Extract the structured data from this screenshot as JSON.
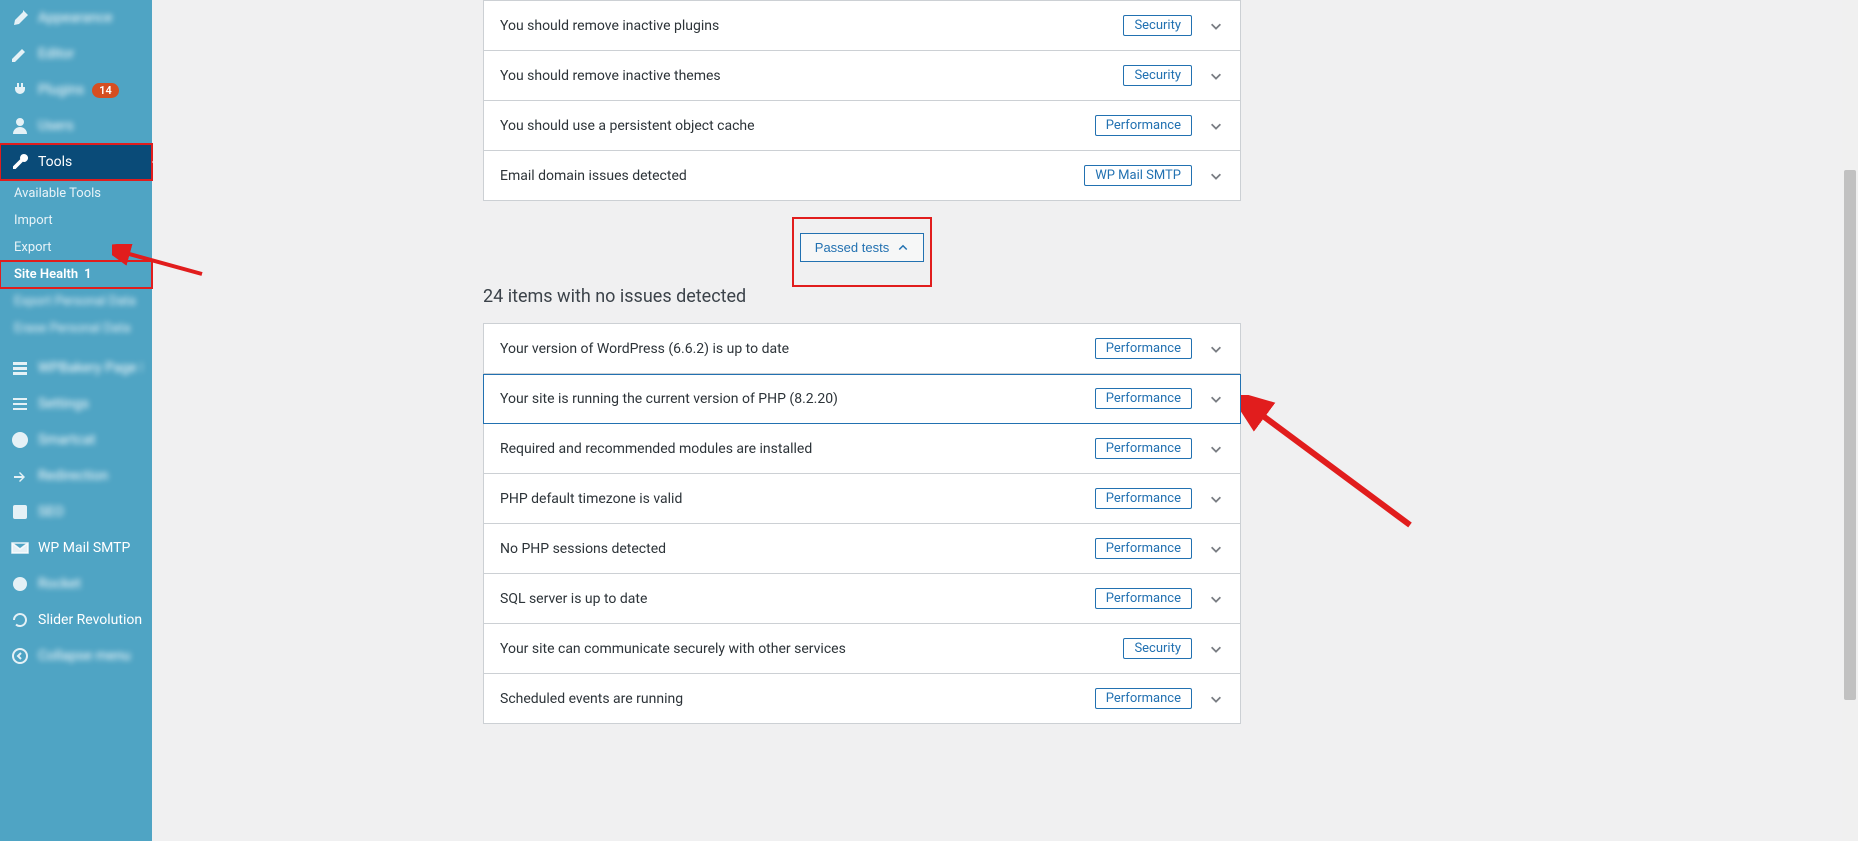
{
  "sidebar": {
    "items_top": [
      {
        "label": "Appearance",
        "icon": "brush"
      },
      {
        "label": "Editor",
        "icon": "pencil"
      },
      {
        "label": "Plugins",
        "icon": "plug",
        "badge": "14"
      },
      {
        "label": "Users",
        "icon": "user"
      }
    ],
    "tools": {
      "label": "Tools"
    },
    "submenu": [
      {
        "label": "Available Tools"
      },
      {
        "label": "Import"
      },
      {
        "label": "Export"
      },
      {
        "label": "Site Health",
        "badge": "1",
        "bold": true
      },
      {
        "label": "Export Personal Data",
        "blur": true
      },
      {
        "label": "Erase Personal Data",
        "blur": true
      }
    ],
    "items_bottom": [
      {
        "label": "WPBakery Page Builder",
        "icon": "layers",
        "blur": true
      },
      {
        "label": "Settings",
        "icon": "sliders",
        "blur": true
      },
      {
        "label": "Smartcat",
        "icon": "whatsapp",
        "blur": true
      },
      {
        "label": "Redirection",
        "icon": "share",
        "blur": true
      },
      {
        "label": "SEO",
        "icon": "seo",
        "blur": true
      },
      {
        "label": "WP Mail SMTP",
        "icon": "mail",
        "blur": false
      },
      {
        "label": "Rocket",
        "icon": "circle",
        "blur": true
      },
      {
        "label": "Slider Revolution",
        "icon": "refresh",
        "blur": false
      },
      {
        "label": "Collapse menu",
        "icon": "collapse",
        "blur": true
      }
    ]
  },
  "recommended": [
    {
      "title": "You should remove inactive plugins",
      "pill": "Security"
    },
    {
      "title": "You should remove inactive themes",
      "pill": "Security"
    },
    {
      "title": "You should use a persistent object cache",
      "pill": "Performance"
    },
    {
      "title": "Email domain issues detected",
      "pill": "WP Mail SMTP"
    }
  ],
  "passed_button": "Passed tests",
  "passed_heading": "24 items with no issues detected",
  "passed": [
    {
      "title": "Your version of WordPress (6.6.2) is up to date",
      "pill": "Performance"
    },
    {
      "title": "Your site is running the current version of PHP (8.2.20)",
      "pill": "Performance",
      "selected": true
    },
    {
      "title": "Required and recommended modules are installed",
      "pill": "Performance"
    },
    {
      "title": "PHP default timezone is valid",
      "pill": "Performance"
    },
    {
      "title": "No PHP sessions detected",
      "pill": "Performance"
    },
    {
      "title": "SQL server is up to date",
      "pill": "Performance"
    },
    {
      "title": "Your site can communicate securely with other services",
      "pill": "Security"
    },
    {
      "title": "Scheduled events are running",
      "pill": "Performance"
    }
  ]
}
